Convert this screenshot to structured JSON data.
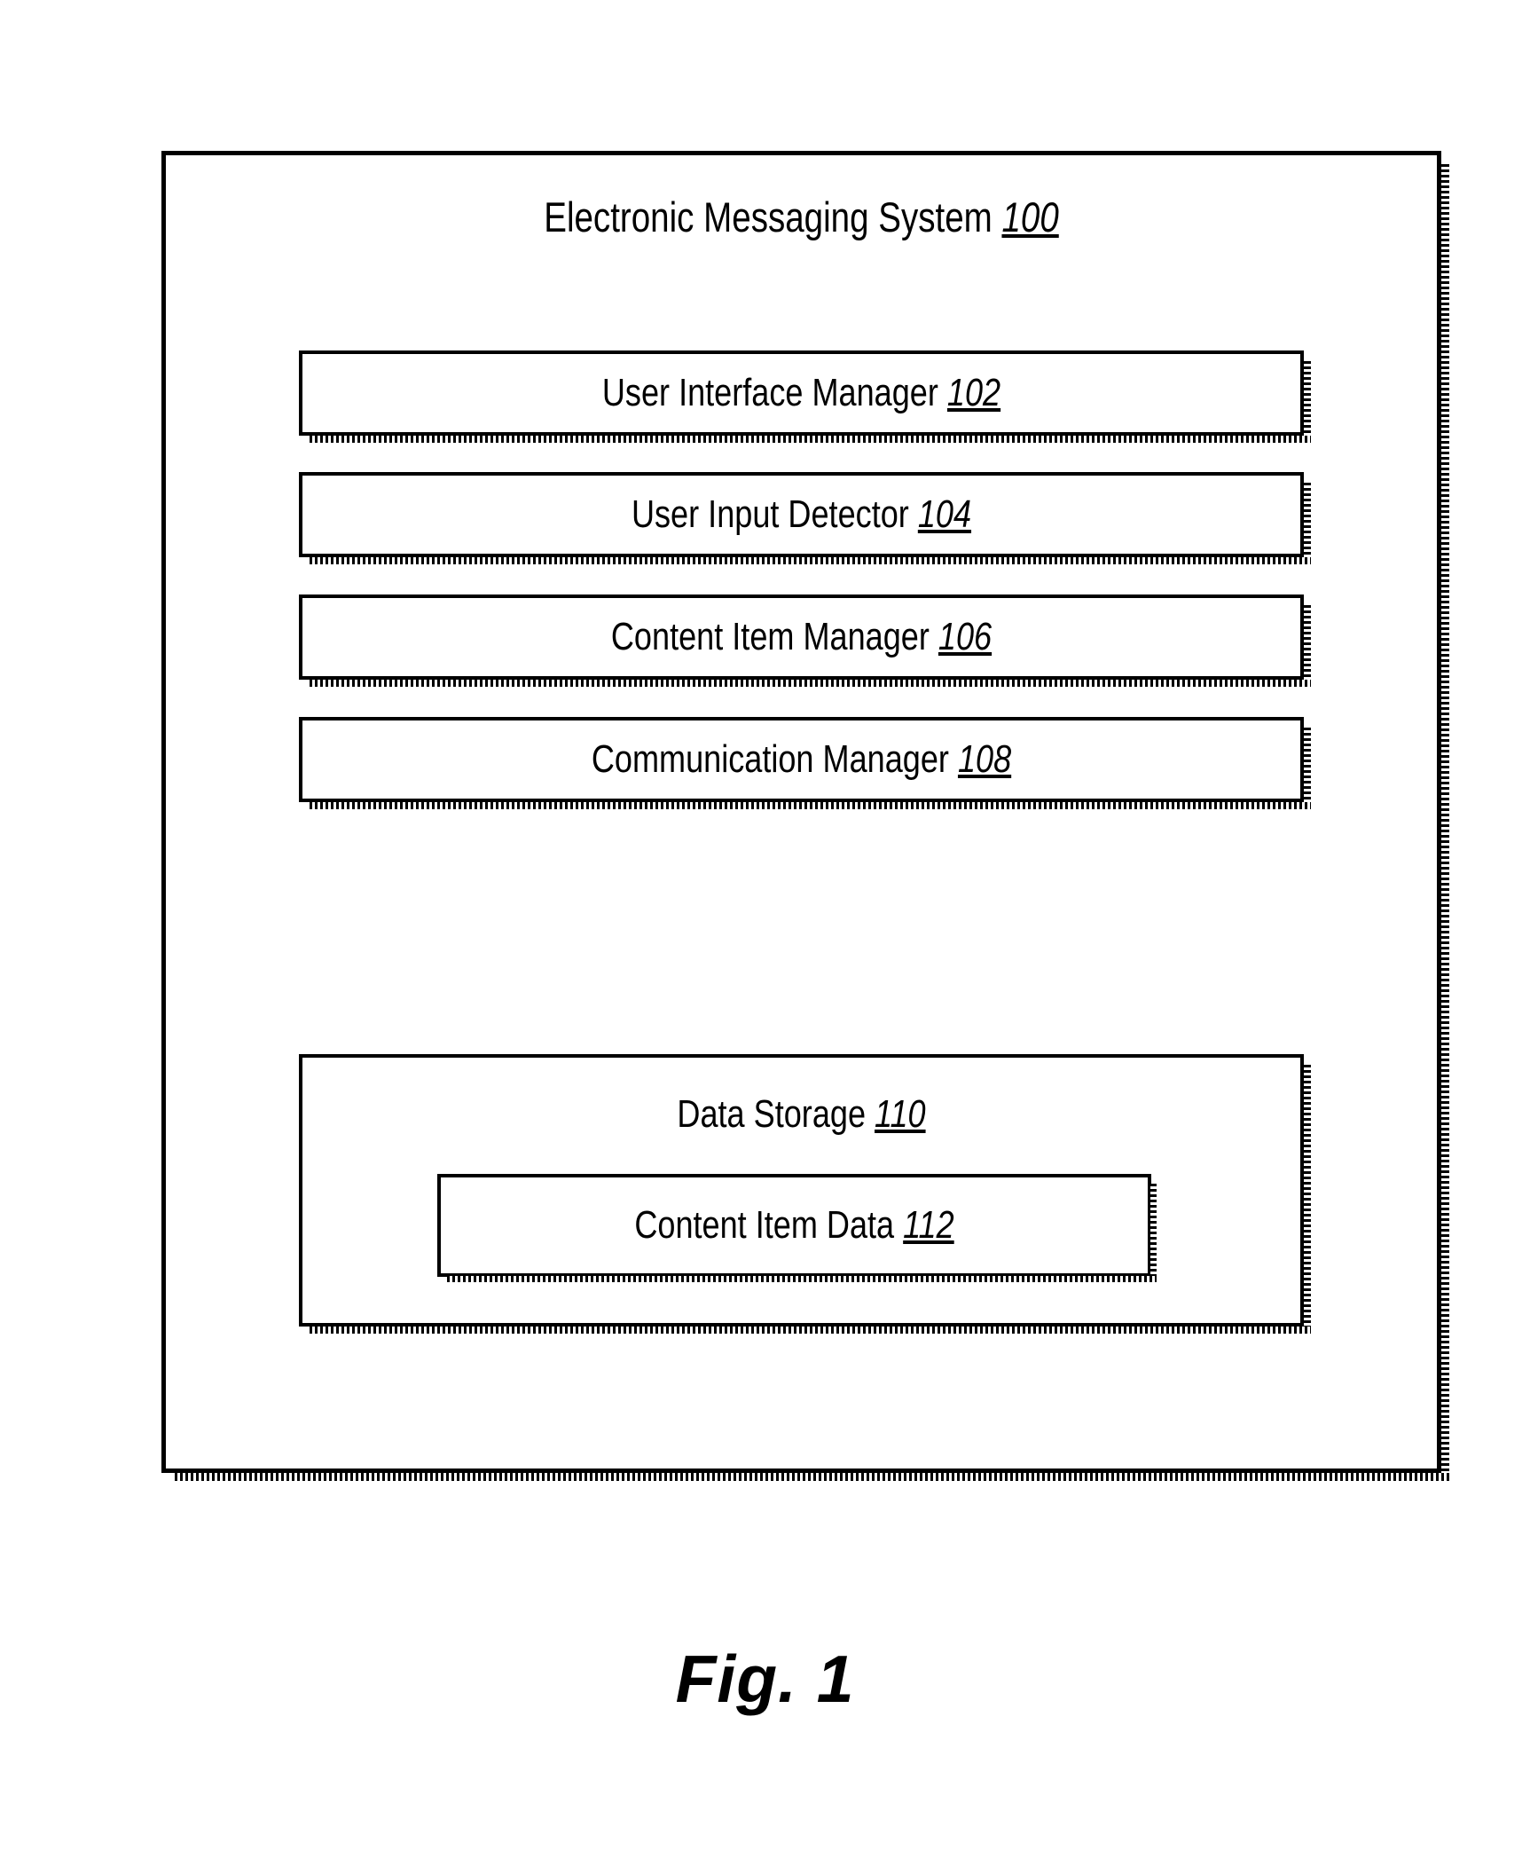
{
  "figure": {
    "caption": "Fig. 1",
    "system": {
      "label": "Electronic Messaging System",
      "ref": "100"
    },
    "components": [
      {
        "label": "User Interface Manager",
        "ref": "102"
      },
      {
        "label": "User Input Detector",
        "ref": "104"
      },
      {
        "label": "Content Item Manager",
        "ref": "106"
      },
      {
        "label": "Communication Manager",
        "ref": "108"
      }
    ],
    "storage": {
      "label": "Data Storage",
      "ref": "110",
      "children": [
        {
          "label": "Content Item  Data",
          "ref": "112"
        }
      ]
    },
    "colors": {
      "ink": "#000000",
      "paper": "#ffffff"
    }
  }
}
